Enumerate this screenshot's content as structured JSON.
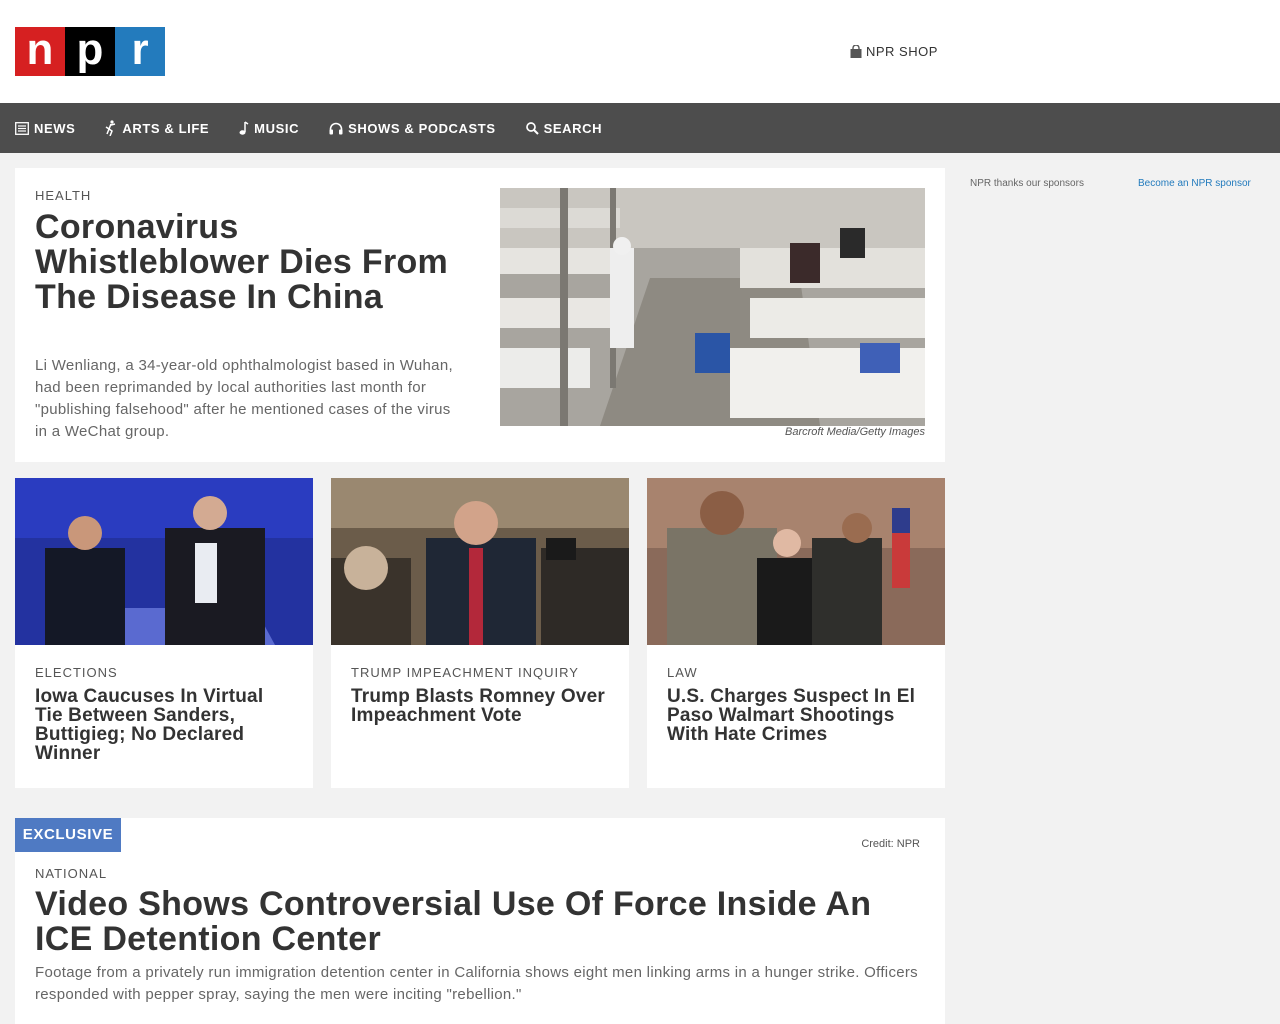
{
  "header": {
    "logo": {
      "n": "n",
      "p": "p",
      "r": "r"
    },
    "shop_label": "NPR SHOP"
  },
  "nav": {
    "items": [
      {
        "label": "NEWS",
        "icon": "news-icon"
      },
      {
        "label": "ARTS & LIFE",
        "icon": "arts-life-icon"
      },
      {
        "label": "MUSIC",
        "icon": "music-note-icon"
      },
      {
        "label": "SHOWS & PODCASTS",
        "icon": "headphones-icon"
      },
      {
        "label": "SEARCH",
        "icon": "search-icon"
      }
    ]
  },
  "lead": {
    "slug": "HEALTH",
    "title": "Coronavirus Whistleblower Dies From The Disease In China",
    "teaser": "Li Wenliang, a 34-year-old ophthalmologist based in Wuhan, had been reprimanded by local authorities last month for \"publishing falsehood\" after he mentioned cases of the virus in a WeChat group.",
    "credit": "Barcroft Media/Getty Images"
  },
  "stories": [
    {
      "slug": "ELECTIONS",
      "title": "Iowa Caucuses In Virtual Tie Between Sanders, Buttigieg; No Declared Winner"
    },
    {
      "slug": "TRUMP IMPEACHMENT INQUIRY",
      "title": "Trump Blasts Romney Over Impeachment Vote"
    },
    {
      "slug": "LAW",
      "title": "U.S. Charges Suspect In El Paso Walmart Shootings With Hate Crimes"
    }
  ],
  "bottom": {
    "badge": "EXCLUSIVE",
    "credit": "Credit: NPR",
    "slug": "NATIONAL",
    "title": "Video Shows Controversial Use Of Force Inside An ICE Detention Center",
    "teaser": "Footage from a privately run immigration detention center in California shows eight men linking arms in a hunger strike. Officers responded with pepper spray, saying the men were inciting \"rebellion.\""
  },
  "sidebar": {
    "sponsor_text": "NPR thanks our sponsors",
    "sponsor_link": "Become an NPR sponsor"
  },
  "colors": {
    "logo_red": "#d62021",
    "logo_black": "#000000",
    "logo_blue": "#237bbd",
    "nav_bg": "#4d4d4d",
    "badge_blue": "#4f7ac3"
  }
}
